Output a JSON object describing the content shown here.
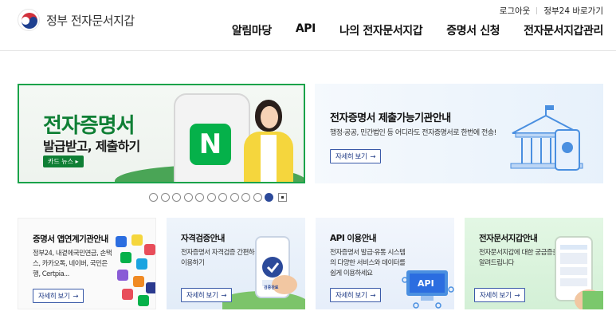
{
  "header": {
    "logo_text": "정부 전자문서지갑",
    "util_links": [
      "로그아웃",
      "정부24 바로가기"
    ],
    "nav": [
      "알림마당",
      "API",
      "나의 전자문서지갑",
      "증명서 신청",
      "전자문서지갑관리"
    ]
  },
  "banners": {
    "left": {
      "title": "전자증명서",
      "subtitle": "발급받고, 제출하기",
      "tag": "카드 뉴스 ▸",
      "app_letter": "N"
    },
    "right": {
      "title": "전자증명서 제출가능기관안내",
      "desc": "행정·공공, 민간법인 등 어디라도 전자증명서로 한번에 전송!",
      "more": "자세히 보기"
    }
  },
  "pager": {
    "total": 11,
    "active": 11
  },
  "cards": [
    {
      "title": "증명서 앱연계기관안내",
      "desc": "정부24, 내곁에국민연금, 손택스, 카카오톡, 네이버, 국민은행, Certpia...",
      "more": "자세히 보기"
    },
    {
      "title": "자격검증안내",
      "desc": "전자증명서 자격검증 간편하게 이용하기",
      "more": "자세히 보기",
      "badge": "검증완료"
    },
    {
      "title": "API 이용안내",
      "desc": "전자증명서 발급·유통 시스템의 다양한 서비스와 데이터를 쉽게 이용하세요",
      "more": "자세히 보기",
      "badge": "API"
    },
    {
      "title": "전자문서지갑안내",
      "desc": "전자문서지갑에 대한 궁금증을 알려드립니다",
      "more": "자세히 보기"
    }
  ],
  "colors": {
    "brand_green": "#0f7f35",
    "accent_blue": "#2c4a9a",
    "button_blue": "#1f3a85"
  }
}
